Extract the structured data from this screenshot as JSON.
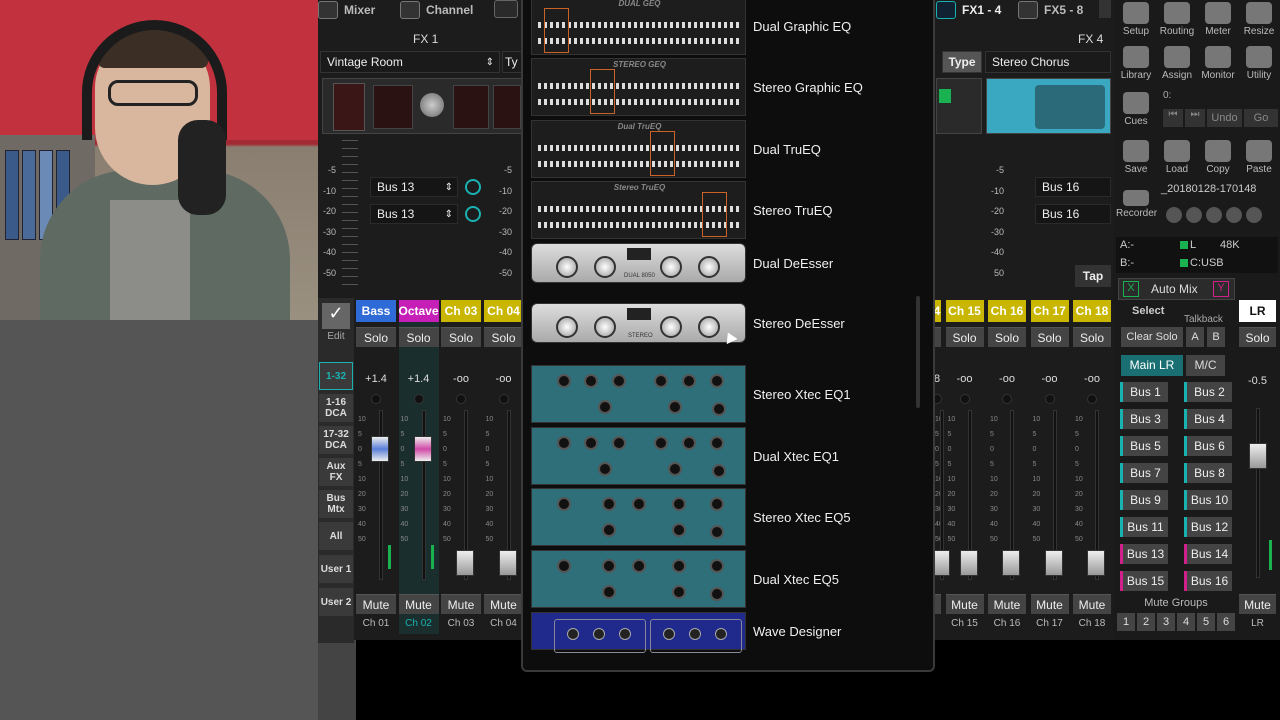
{
  "top_tabs": {
    "mixer": "Mixer",
    "channel": "Channel",
    "fx1_4": "FX1 - 4",
    "fx5_8": "FX5 - 8"
  },
  "fx_left": {
    "title": "FX 1",
    "preset": "Vintage Room",
    "type_short": "Ty",
    "bus_a": "Bus 13",
    "bus_b": "Bus 13"
  },
  "fx_right": {
    "title": "FX 4",
    "type_btn": "Type",
    "preset": "Stereo Chorus",
    "bus_a": "Bus 16",
    "bus_b": "Bus 16",
    "tap": "Tap"
  },
  "meter_scale": [
    "-5",
    "-10",
    "-20",
    "-30",
    "-40",
    "-50"
  ],
  "meter_scale_mid": [
    "-5",
    "-10",
    "-20",
    "-30",
    "-40",
    "-50"
  ],
  "meter_scale_right": [
    "-5",
    "-10",
    "-20",
    "-30",
    "-40",
    "50"
  ],
  "left_nav": {
    "edit": "Edit",
    "b1": "1-32",
    "b2": "1-16\nDCA",
    "b3": "17-32\nDCA",
    "b4": "Aux\nFX",
    "b5": "Bus\nMtx",
    "b6": "All",
    "b7": "User 1",
    "b8": "User 2"
  },
  "channels_left": [
    {
      "name": "Bass",
      "color": "#2f6bd6",
      "solo": "Solo",
      "level": "+1.4",
      "mute": "Mute",
      "label": "Ch 01"
    },
    {
      "name": "Octave",
      "color": "#c61fb8",
      "solo": "Solo",
      "level": "+1.4",
      "mute": "Mute",
      "label": "Ch 02"
    },
    {
      "name": "Ch 03",
      "color": "#c9b600",
      "solo": "Solo",
      "level": "-oo",
      "mute": "Mute",
      "label": "Ch 03"
    },
    {
      "name": "Ch 04",
      "color": "#c9b600",
      "solo": "Solo",
      "level": "-oo",
      "mute": "Mute",
      "label": "Ch 04"
    }
  ],
  "channels_right": [
    {
      "name": "4",
      "solo": "",
      "level": "8",
      "mute": "",
      "label": ""
    },
    {
      "name": "Ch 15",
      "solo": "Solo",
      "level": "-oo",
      "mute": "Mute",
      "label": "Ch 15"
    },
    {
      "name": "Ch 16",
      "solo": "Solo",
      "level": "-oo",
      "mute": "Mute",
      "label": "Ch 16"
    },
    {
      "name": "Ch 17",
      "solo": "Solo",
      "level": "-oo",
      "mute": "Mute",
      "label": "Ch 17"
    },
    {
      "name": "Ch 18",
      "solo": "Solo",
      "level": "-oo",
      "mute": "Mute",
      "label": "Ch 18"
    }
  ],
  "fader_scale": [
    "10",
    "5",
    "0",
    "5",
    "10",
    "20",
    "30",
    "40",
    "50"
  ],
  "fx_list": [
    "Dual Graphic EQ",
    "Stereo Graphic EQ",
    "Dual TruEQ",
    "Stereo TruEQ",
    "Dual DeEsser",
    "Stereo DeEsser",
    "Stereo Xtec EQ1",
    "Dual Xtec EQ1",
    "Stereo Xtec EQ5",
    "Dual Xtec EQ5",
    "Wave Designer"
  ],
  "thumb_titles": {
    "dual_geq": "DUAL GEQ",
    "stereo_geq": "STEREO GEQ",
    "dual_trueq": "Dual TruEQ",
    "stereo_trueq": "Stereo TruEQ",
    "dual_deesser_tag": "DUAL 8050",
    "stereo_deesser_tag": "STEREO"
  },
  "right_panel": {
    "tools": [
      "Setup",
      "Routing",
      "Meter",
      "Resize",
      "Library",
      "Assign",
      "Monitor",
      "Utility"
    ],
    "cues": "Cues",
    "cue_value": "0:",
    "undo": "Undo",
    "go": "Go",
    "file_btns": [
      "Save",
      "Load",
      "Copy",
      "Paste"
    ],
    "recorder": "Recorder",
    "recorder_file": "_20180128-170148",
    "a_label": "A:-",
    "b_label": "B:-",
    "l_label": "L",
    "rate": "48K",
    "usb": "C:USB",
    "x": "X",
    "automix": "Auto Mix",
    "y": "Y",
    "select": "Select",
    "talkback": "Talkback",
    "clear_solo": "Clear Solo",
    "a": "A",
    "b": "B",
    "main_lr": "Main LR",
    "mc": "M/C",
    "buses": [
      "Bus 1",
      "Bus 2",
      "Bus 3",
      "Bus 4",
      "Bus 5",
      "Bus 6",
      "Bus 7",
      "Bus 8",
      "Bus 9",
      "Bus 10",
      "Bus 11",
      "Bus 12",
      "Bus 13",
      "Bus 14",
      "Bus 15",
      "Bus 16"
    ],
    "mute_groups": "Mute Groups",
    "mute_group_nums": [
      "1",
      "2",
      "3",
      "4",
      "5",
      "6"
    ],
    "lr": "LR",
    "lr_solo": "Solo",
    "lr_level": "-0.5",
    "lr_mute": "Mute",
    "lr_label": "LR"
  }
}
